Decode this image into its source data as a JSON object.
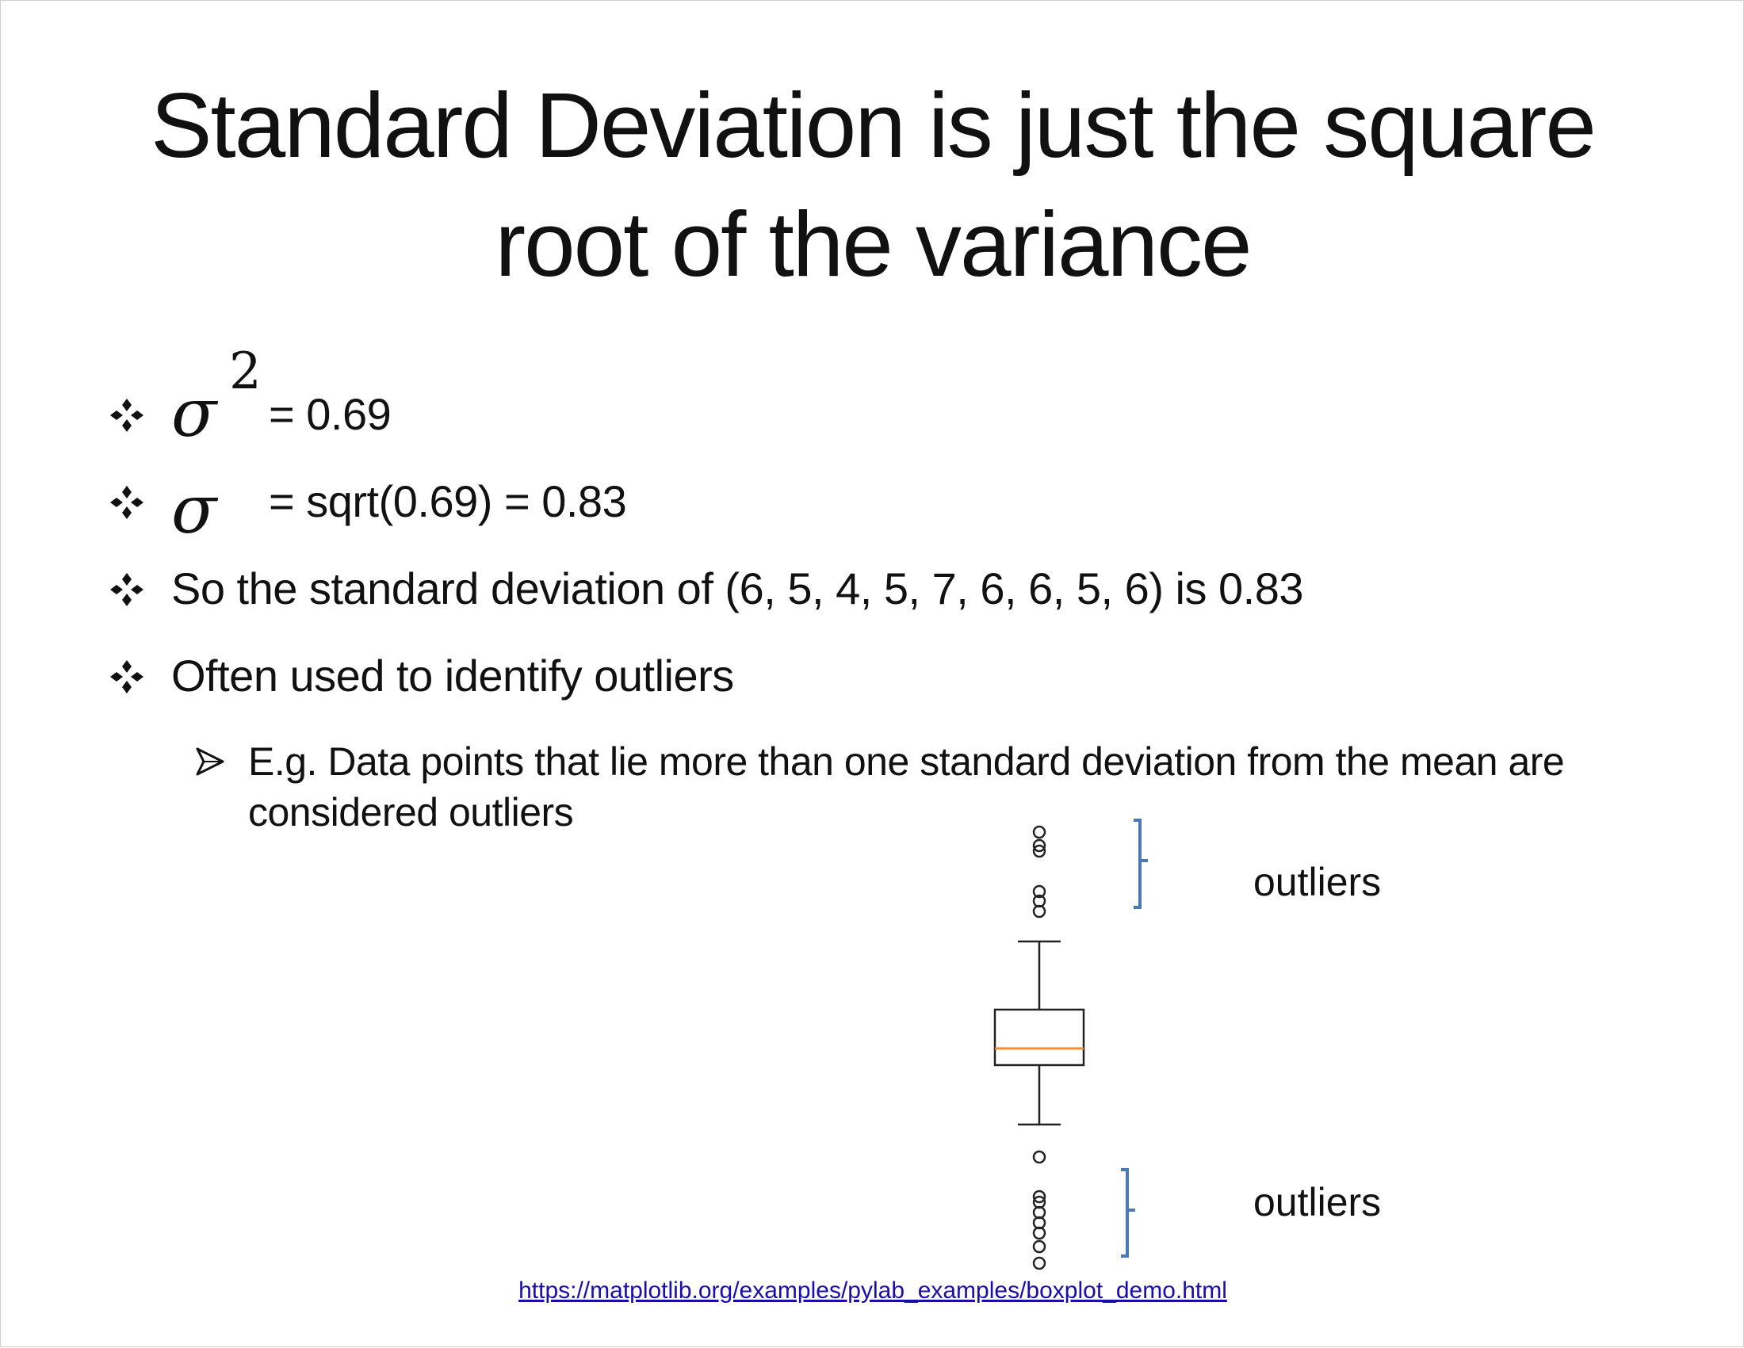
{
  "slide": {
    "title_line1": "Standard Deviation is just the square",
    "title_line2": "root of the variance"
  },
  "bullets": [
    {
      "symbol": "σ",
      "superscript": "2",
      "text": "= 0.69"
    },
    {
      "symbol": "σ",
      "text": "= sqrt(0.69) = 0.83"
    },
    {
      "text": "So the standard deviation of (6, 5, 4, 5, 7, 6, 6, 5, 6) is 0.83"
    },
    {
      "text": "Often used to identify outliers"
    }
  ],
  "sub_bullet": {
    "line1": "E.g. Data points that lie more than one standard deviation from the mean are",
    "line2": "considered outliers"
  },
  "figure": {
    "upper_label": "outliers",
    "lower_label": "outliers",
    "colors": {
      "box": "#222222",
      "median": "#f28e2b",
      "bracket": "#4a7ab5",
      "link": "#1a0dab"
    }
  },
  "source_link": "https://matplotlib.org/examples/pylab_examples/boxplot_demo.html"
}
